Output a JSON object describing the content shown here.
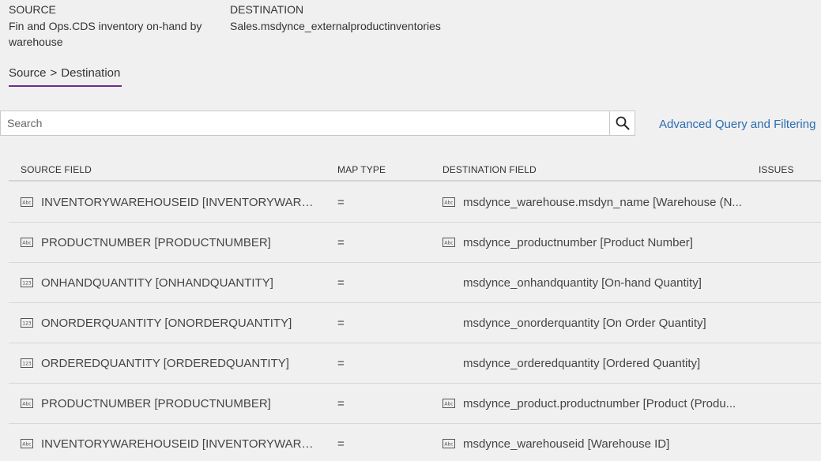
{
  "header": {
    "source_label": "SOURCE",
    "source_value": "Fin and Ops.CDS inventory on-hand by warehouse",
    "destination_label": "DESTINATION",
    "destination_value": "Sales.msdynce_externalproductinventories"
  },
  "breadcrumb": {
    "source": "Source",
    "separator": ">",
    "destination": "Destination"
  },
  "search": {
    "placeholder": "Search",
    "value": ""
  },
  "advanced_link": "Advanced Query and Filtering",
  "columns": {
    "source_field": "SOURCE FIELD",
    "map_type": "MAP TYPE",
    "destination_field": "DESTINATION FIELD",
    "issues": "ISSUES"
  },
  "rows": [
    {
      "src_icon": "abc-text-icon",
      "source": "INVENTORYWAREHOUSEID [INVENTORYWAREHO...",
      "map": "=",
      "dst_icon": "abc-text-icon",
      "destination": "msdynce_warehouse.msdyn_name [Warehouse (N..."
    },
    {
      "src_icon": "abc-text-icon",
      "source": "PRODUCTNUMBER [PRODUCTNUMBER]",
      "map": "=",
      "dst_icon": "abc-text-icon",
      "destination": "msdynce_productnumber [Product Number]"
    },
    {
      "src_icon": "numeric-123-icon",
      "source": "ONHANDQUANTITY [ONHANDQUANTITY]",
      "map": "=",
      "dst_icon": "",
      "destination": "msdynce_onhandquantity [On-hand Quantity]"
    },
    {
      "src_icon": "numeric-123-icon",
      "source": "ONORDERQUANTITY [ONORDERQUANTITY]",
      "map": "=",
      "dst_icon": "",
      "destination": "msdynce_onorderquantity [On Order Quantity]"
    },
    {
      "src_icon": "numeric-123-icon",
      "source": "ORDEREDQUANTITY [ORDEREDQUANTITY]",
      "map": "=",
      "dst_icon": "",
      "destination": "msdynce_orderedquantity [Ordered Quantity]"
    },
    {
      "src_icon": "abc-text-icon",
      "source": "PRODUCTNUMBER [PRODUCTNUMBER]",
      "map": "=",
      "dst_icon": "abc-text-icon",
      "destination": "msdynce_product.productnumber [Product (Produ..."
    },
    {
      "src_icon": "abc-text-icon",
      "source": "INVENTORYWAREHOUSEID [INVENTORYWAREHO...",
      "map": "=",
      "dst_icon": "abc-text-icon",
      "destination": "msdynce_warehouseid [Warehouse ID]"
    }
  ],
  "colors": {
    "accent_underline": "#6b2e8e",
    "link": "#2b6cb0",
    "background": "#f0f0f0"
  }
}
